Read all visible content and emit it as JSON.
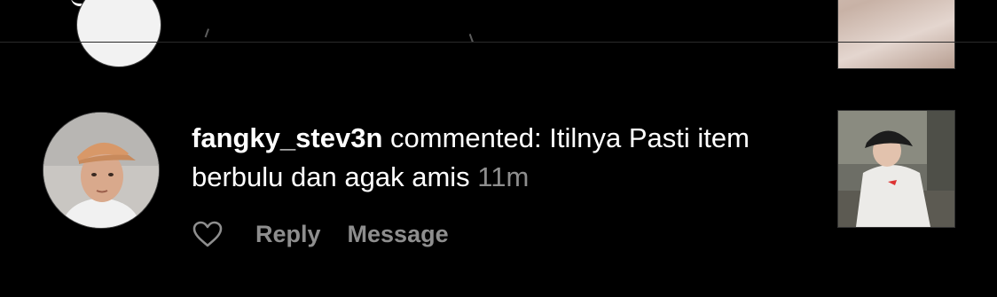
{
  "comment": {
    "username": "fangky_stev3n",
    "action_text": "commented:",
    "body": "Itilnya Pasti item berbulu dan agak amis",
    "timestamp": "11m"
  },
  "actions": {
    "reply_label": "Reply",
    "message_label": "Message"
  },
  "icons": {
    "like": "heart-outline-icon"
  },
  "colors": {
    "background": "#000000",
    "primary_text": "#ffffff",
    "secondary_text": "#8e8e8e",
    "divider": "#2b2b2b"
  }
}
